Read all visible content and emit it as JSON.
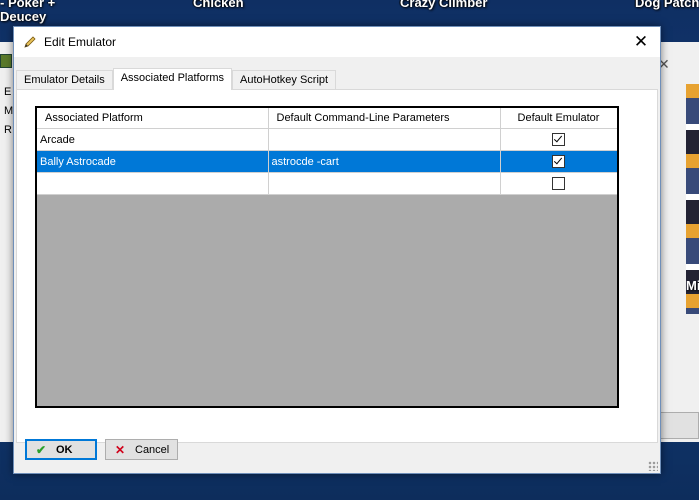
{
  "desktop": {
    "games": [
      "- Poker +",
      "Deucey",
      "Chicken",
      "Crazy Climber",
      "Dog Patch",
      "Mis"
    ]
  },
  "background_window": {
    "left_labels": [
      "E",
      "M",
      "R"
    ]
  },
  "dialog": {
    "title": "Edit Emulator",
    "close_glyph": "✕",
    "tabs": [
      {
        "label": "Emulator Details",
        "active": false
      },
      {
        "label": "Associated Platforms",
        "active": true
      },
      {
        "label": "AutoHotkey Script",
        "active": false
      }
    ],
    "grid": {
      "columns": [
        "Associated Platform",
        "Default Command-Line Parameters",
        "Default Emulator"
      ],
      "rows": [
        {
          "platform": "Arcade",
          "params": "",
          "default": true,
          "selected": false
        },
        {
          "platform": "Bally Astrocade",
          "params": "astrocde -cart",
          "default": true,
          "selected": true
        },
        {
          "platform": "",
          "params": "",
          "default": false,
          "selected": false
        }
      ]
    },
    "buttons": {
      "ok": {
        "label": "OK",
        "icon": "check-icon"
      },
      "cancel": {
        "label": "Cancel",
        "icon": "x-icon"
      }
    }
  },
  "colors": {
    "selection": "#0078d7",
    "grid_empty": "#ababab"
  }
}
